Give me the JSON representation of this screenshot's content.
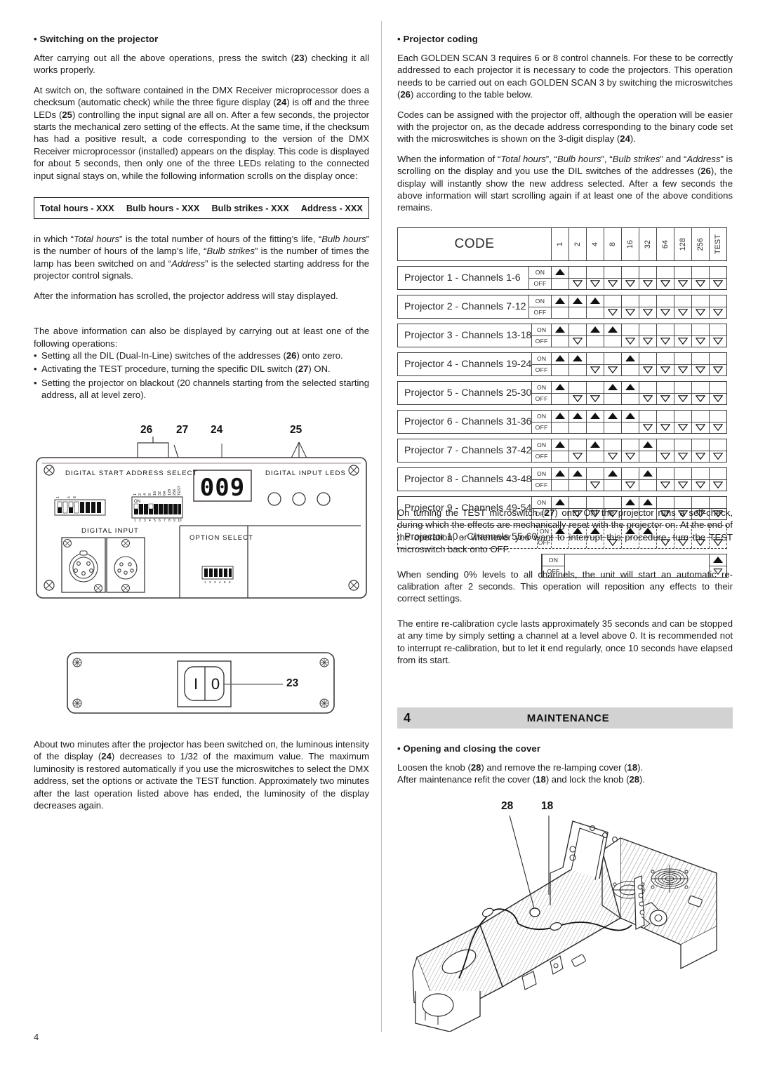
{
  "page": {
    "number": "4"
  },
  "left": {
    "section_heading": "Switching on the projector",
    "p1": "After carrying out all the above operations, press the switch (23) checking it all works properly.",
    "p2": "At switch on, the software contained in the DMX Receiver microprocessor does a checksum (automatic check) while the three figure display (24) is off and the three LEDs (25) controlling the input signal are all on. After a few seconds, the projector starts the mechanical zero setting of the effects. At the same time, if the checksum has had a positive result, a code corresponding to the version of the DMX Receiver microprocessor (installed) appears on the display. This code is displayed for about 5 seconds, then only one of the three LEDs relating to the connected input signal stays on, while the following information scrolls on the display once:",
    "scroll_items": [
      "Total hours - XXX",
      "Bulb hours - XXX",
      "Bulb strikes - XXX",
      "Address - XXX"
    ],
    "p3": "in which “Total hours” is the total number of hours of the fitting’s life, “Bulb hours” is the number of hours of the lamp’s life, “Bulb strikes” is the number of times the lamp has been switched on and “Address” is the selected starting address for the projector control signals.",
    "p4": "After the information has scrolled, the projector address will stay displayed.",
    "p5": "The above information can also be displayed by carrying out at least one of the following operations:",
    "operations": [
      "Setting all the DIL (Dual-In-Line) switches of the addresses (26) onto zero.",
      "Activating the TEST procedure, turning the specific DIL switch (27) ON.",
      "Setting the projector on blackout (20 channels starting from the selected starting address, all at level zero)."
    ],
    "p6": "About two minutes after the projector has been switched on, the luminous intensity of the display (24) decreases to 1/32 of the maximum value. The maximum luminosity is restored automatically if you use the microswitches to select the DMX address, set the options or activate the TEST function. Approximately two minutes after the last operation listed above has ended, the luminosity of the display decreases again."
  },
  "panel_diagram": {
    "callouts": [
      "26",
      "27",
      "24",
      "25"
    ],
    "labels": {
      "address_select": "DIGITAL START ADDRESS SELECT",
      "digital_input": "DIGITAL INPUT",
      "input_leds": "DIGITAL INPUT LEDS",
      "option_select": "OPTION SELECT"
    },
    "display_value": "009",
    "dip_on_label": "ON",
    "dip_weight_labels": [
      "1",
      "2",
      "4",
      "8",
      "16",
      "32",
      "64",
      "128",
      "256",
      "TEST"
    ],
    "dip_index_labels": [
      "1",
      "2",
      "3",
      "4",
      "5",
      "6",
      "7",
      "8",
      "9",
      "10"
    ],
    "option_index_labels": [
      "1",
      "2",
      "3",
      "4",
      "5",
      "6"
    ]
  },
  "switch_diagram": {
    "callout": "23",
    "on_symbol": "I",
    "off_symbol": "0"
  },
  "right": {
    "section_heading": "Projector coding",
    "p1": "Each GOLDEN SCAN 3 requires 6 or 8 control channels. For these to be correctly addressed to each projector it is necessary to code the projectors. This operation needs to be carried out on each GOLDEN SCAN 3 by switching the microswitches (26) according to the table below.",
    "p2": "Codes can be assigned with the projector off, although the operation will be easier with the projector on, as the decade address corresponding to the binary code set with the microswitches is shown on the 3-digit display (24).",
    "p3": "When the information of “Total hours”, “Bulb hours”, “Bulb strikes” and “Address” is scrolling on the display and you use the DIL switches of the addresses (26), the display will instantly show the new address selected. After a few seconds the above information will start scrolling again if at least one of the above conditions remains.",
    "p4": "On turning the TEST microswitch (27) onto ON the projector runs a self-check, during which the effects are mechanically reset with the projector on. At the end of the operation, or whenever you want to interrupt this procedure, turn the TEST microswitch back onto OFF.",
    "p5": "When sending 0% levels to all channels, the unit will start an automatic re-calibration after 2 seconds. This operation will reposition any effects to their correct settings.",
    "p6": "The entire re-calibration cycle lasts approximately 35 seconds and can be stopped at any time by simply setting a channel at a level above 0. It is recommended not to interrupt re-calibration, but to let it end regularly, once 10 seconds have elapsed from its start."
  },
  "code_table": {
    "title": "CODE",
    "weight_headers": [
      "1",
      "2",
      "4",
      "8",
      "16",
      "32",
      "64",
      "128",
      "256",
      "TEST"
    ],
    "on_label": "ON",
    "off_label": "OFF",
    "rows": [
      {
        "label": "Projector  1  - Channels  1-6",
        "bits": [
          1,
          0,
          0,
          0,
          0,
          0,
          0,
          0,
          0,
          0
        ],
        "dashed": false
      },
      {
        "label": "Projector  2  - Channels  7-12",
        "bits": [
          1,
          1,
          1,
          0,
          0,
          0,
          0,
          0,
          0,
          0
        ],
        "dashed": false
      },
      {
        "label": "Projector  3  - Channels  13-18",
        "bits": [
          1,
          0,
          1,
          1,
          0,
          0,
          0,
          0,
          0,
          0
        ],
        "dashed": false
      },
      {
        "label": "Projector  4  - Channels  19-24",
        "bits": [
          1,
          1,
          0,
          0,
          1,
          0,
          0,
          0,
          0,
          0
        ],
        "dashed": false
      },
      {
        "label": "Projector  5  - Channels  25-30",
        "bits": [
          1,
          0,
          0,
          1,
          1,
          0,
          0,
          0,
          0,
          0
        ],
        "dashed": false
      },
      {
        "label": "Projector  6  - Channels  31-36",
        "bits": [
          1,
          1,
          1,
          1,
          1,
          0,
          0,
          0,
          0,
          0
        ],
        "dashed": false
      },
      {
        "label": "Projector  7  - Channels  37-42",
        "bits": [
          1,
          0,
          1,
          0,
          0,
          1,
          0,
          0,
          0,
          0
        ],
        "dashed": false
      },
      {
        "label": "Projector  8  - Channels  43-48",
        "bits": [
          1,
          1,
          0,
          1,
          0,
          1,
          0,
          0,
          0,
          0
        ],
        "dashed": false
      },
      {
        "label": "Projector  9  - Channels  49-54",
        "bits": [
          1,
          0,
          0,
          0,
          1,
          1,
          0,
          0,
          0,
          0
        ],
        "dashed": false
      },
      {
        "label": "Projector  10 - Channels  55-60",
        "bits": [
          1,
          1,
          1,
          0,
          1,
          1,
          0,
          0,
          0,
          0
        ],
        "dashed": true
      }
    ],
    "test_row": {
      "bits": [
        0,
        0,
        0,
        0,
        0,
        0,
        0,
        0,
        0,
        2
      ]
    }
  },
  "maintenance": {
    "number": "4",
    "title": "MAINTENANCE",
    "section_heading": "Opening and closing the cover",
    "p1": "Loosen the knob (28) and remove the re-lamping cover (18).",
    "p2": "After maintenance refit the cover (18) and lock the knob (28)."
  },
  "projector_diagram": {
    "callouts": [
      "28",
      "18"
    ]
  }
}
